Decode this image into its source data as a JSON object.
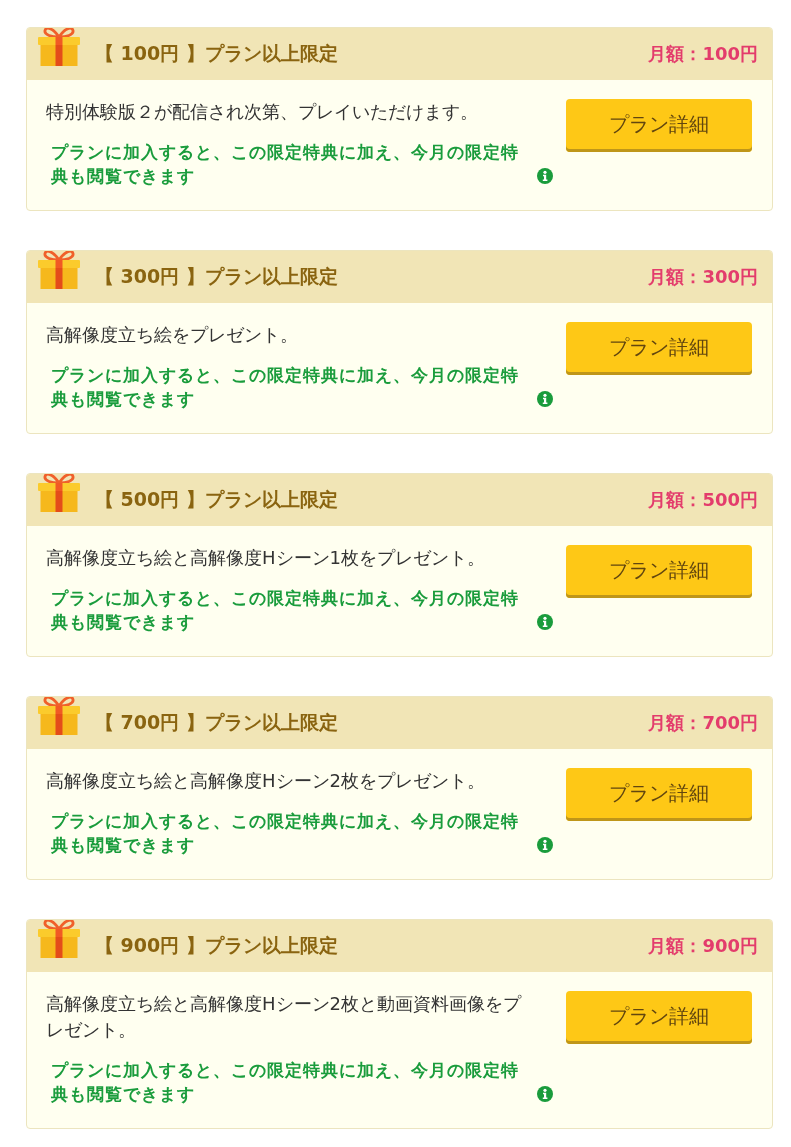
{
  "plans": [
    {
      "title": "【 100円 】プラン以上限定",
      "price": "月額：100円",
      "description": "特別体験版２が配信され次第、プレイいただけます。",
      "note": "プランに加入すると、この限定特典に加え、今月の限定特典も閲覧できます",
      "button": "プラン詳細"
    },
    {
      "title": "【 300円 】プラン以上限定",
      "price": "月額：300円",
      "description": "高解像度立ち絵をプレゼント。",
      "note": "プランに加入すると、この限定特典に加え、今月の限定特典も閲覧できます",
      "button": "プラン詳細"
    },
    {
      "title": "【 500円 】プラン以上限定",
      "price": "月額：500円",
      "description": "高解像度立ち絵と高解像度Hシーン1枚をプレゼント。",
      "note": "プランに加入すると、この限定特典に加え、今月の限定特典も閲覧できます",
      "button": "プラン詳細"
    },
    {
      "title": "【 700円 】プラン以上限定",
      "price": "月額：700円",
      "description": "高解像度立ち絵と高解像度Hシーン2枚をプレゼント。",
      "note": "プランに加入すると、この限定特典に加え、今月の限定特典も閲覧できます",
      "button": "プラン詳細"
    },
    {
      "title": "【 900円 】プラン以上限定",
      "price": "月額：900円",
      "description": "高解像度立ち絵と高解像度Hシーン2枚と動画資料画像をプレゼント。",
      "note": "プランに加入すると、この限定特典に加え、今月の限定特典も閲覧できます",
      "button": "プラン詳細"
    }
  ]
}
